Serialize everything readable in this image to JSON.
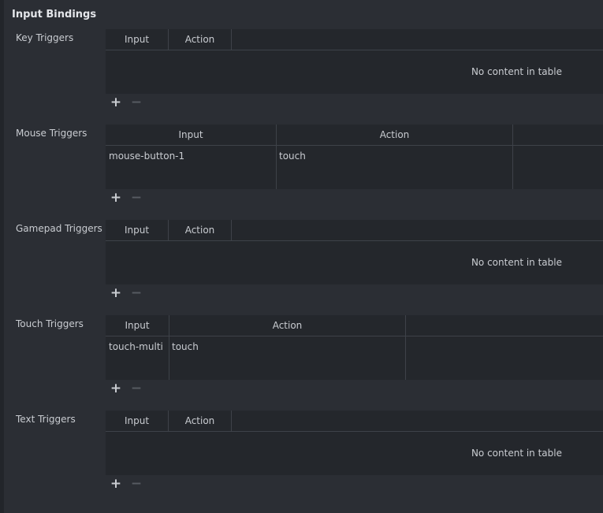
{
  "panel": {
    "title": "Input Bindings"
  },
  "sections": [
    {
      "id": "key",
      "label": "Key Triggers",
      "columns": [
        "Input",
        "Action"
      ],
      "rows": [],
      "empty_text": "No content in table",
      "add_icon": "plus-icon",
      "remove_icon": "minus-icon"
    },
    {
      "id": "mouse",
      "label": "Mouse Triggers",
      "columns": [
        "Input",
        "Action"
      ],
      "rows": [
        {
          "input": "mouse-button-1",
          "action": "touch"
        }
      ],
      "add_icon": "plus-icon",
      "remove_icon": "minus-icon"
    },
    {
      "id": "gamepad",
      "label": "Gamepad Triggers",
      "columns": [
        "Input",
        "Action"
      ],
      "rows": [],
      "empty_text": "No content in table",
      "add_icon": "plus-icon",
      "remove_icon": "minus-icon"
    },
    {
      "id": "touch",
      "label": "Touch Triggers",
      "columns": [
        "Input",
        "Action"
      ],
      "rows": [
        {
          "input": "touch-multi",
          "action": "touch"
        }
      ],
      "add_icon": "plus-icon",
      "remove_icon": "minus-icon"
    },
    {
      "id": "text",
      "label": "Text Triggers",
      "columns": [
        "Input",
        "Action"
      ],
      "rows": [],
      "empty_text": "No content in table",
      "add_icon": "plus-icon",
      "remove_icon": "minus-icon"
    }
  ],
  "colors": {
    "background": "#2b2e34",
    "table_background": "#24272c",
    "text": "#c9ccd1",
    "title": "#e4e6ea",
    "disabled": "#575b62"
  }
}
